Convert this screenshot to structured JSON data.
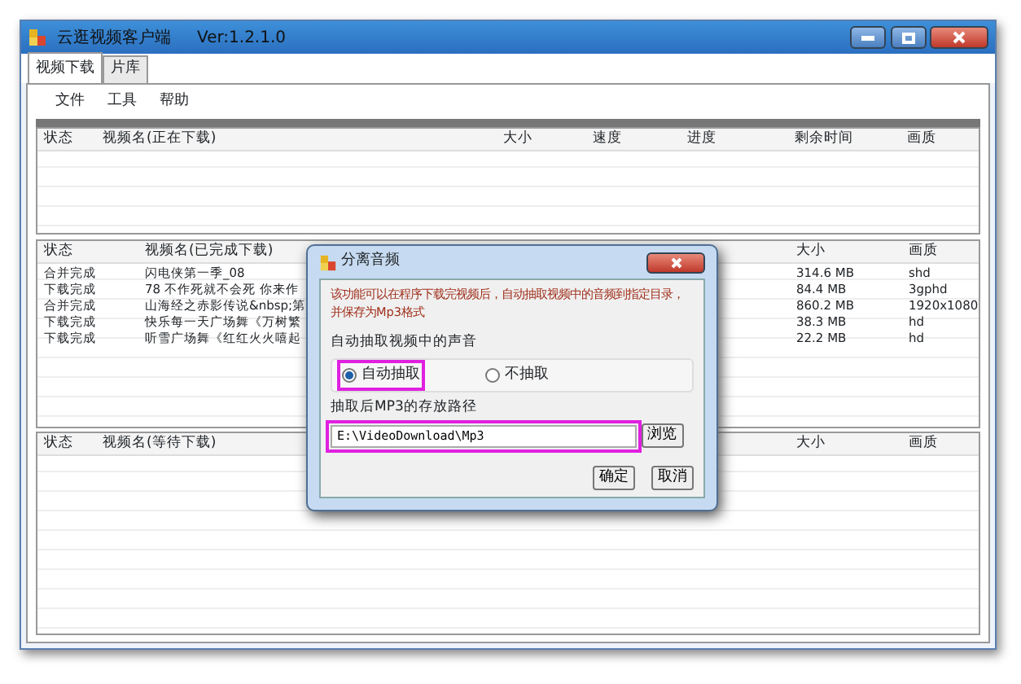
{
  "window": {
    "title": "云逛视频客户端",
    "version": "Ver:1.2.1.0"
  },
  "tabs": [
    {
      "label": "视频下载",
      "selected": true
    },
    {
      "label": "片库",
      "selected": false
    }
  ],
  "menu": [
    "文件",
    "工具",
    "帮助"
  ],
  "downloading": {
    "columns": [
      "状态",
      "视频名(正在下载)",
      "大小",
      "速度",
      "进度",
      "剩余时间",
      "画质"
    ]
  },
  "completed": {
    "columns": [
      "状态",
      "视频名(已完成下载)",
      "大小",
      "画质"
    ],
    "rows": [
      {
        "status": "合并完成",
        "name": "闪电侠第一季_08",
        "size": "314.6 MB",
        "quality": "shd"
      },
      {
        "status": "下载完成",
        "name": "78 不作死就不会死 你来作",
        "size": "84.4 MB",
        "quality": "3gphd"
      },
      {
        "status": "合并完成",
        "name": "山海经之赤影传说&nbsp;第",
        "size": "860.2 MB",
        "quality": "1920x1080"
      },
      {
        "status": "下载完成",
        "name": "快乐每一天广场舞《万树繁",
        "size": "38.3 MB",
        "quality": "hd"
      },
      {
        "status": "下载完成",
        "name": "听雪广场舞《红红火火嘻起",
        "size": "22.2 MB",
        "quality": "hd"
      }
    ]
  },
  "waiting": {
    "columns": [
      "状态",
      "视频名(等待下载)",
      "大小",
      "画质"
    ]
  },
  "dialog": {
    "title": "分离音频",
    "description": "该功能可以在程序下载完视频后，自动抽取视频中的音频到指定目录，并保存为Mp3格式",
    "group_label": "自动抽取视频中的声音",
    "options": [
      {
        "label": "自动抽取",
        "selected": true
      },
      {
        "label": "不抽取",
        "selected": false
      }
    ],
    "path_label": "抽取后MP3的存放路径",
    "path_value": "E:\\VideoDownload\\Mp3",
    "browse_button": "浏览",
    "buttons": [
      "确定",
      "取消"
    ]
  }
}
